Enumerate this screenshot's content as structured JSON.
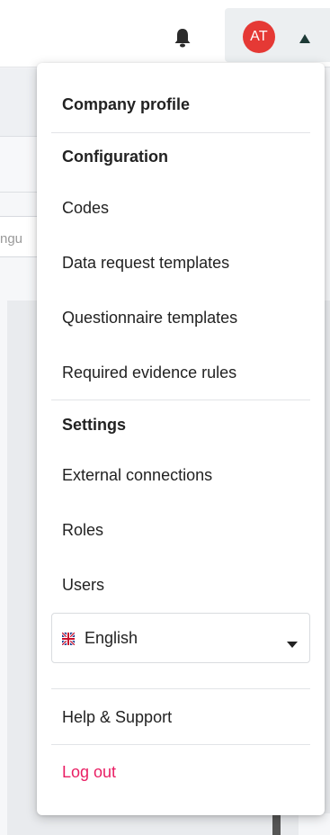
{
  "header": {
    "avatar_initials": "AT",
    "avatar_color": "#e53935"
  },
  "background": {
    "input_fragment": "ngu"
  },
  "menu": {
    "company_profile": "Company profile",
    "configuration_heading": "Configuration",
    "configuration_items": [
      "Codes",
      "Data request templates",
      "Questionnaire templates",
      "Required evidence rules"
    ],
    "settings_heading": "Settings",
    "settings_items": [
      "External connections",
      "Roles",
      "Users"
    ],
    "language": {
      "selected": "English",
      "flag_icon": "uk-flag-icon"
    },
    "help": "Help & Support",
    "logout": "Log out",
    "logout_color": "#e91e63"
  }
}
